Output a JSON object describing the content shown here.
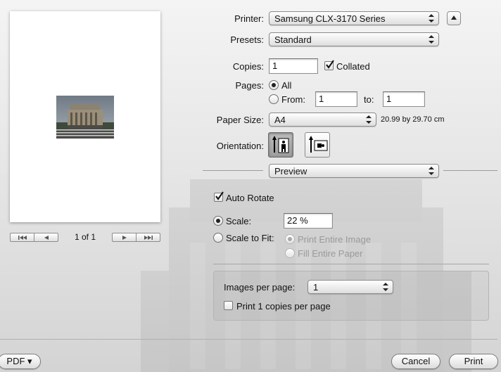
{
  "preview": {
    "page_indicator": "1 of 1"
  },
  "printer": {
    "label": "Printer:",
    "value": "Samsung CLX-3170 Series"
  },
  "presets": {
    "label": "Presets:",
    "value": "Standard"
  },
  "copies": {
    "label": "Copies:",
    "value": "1",
    "collated_label": "Collated",
    "collated_checked": true
  },
  "pages": {
    "label": "Pages:",
    "all_label": "All",
    "from_label": "From:",
    "from_value": "1",
    "to_label": "to:",
    "to_value": "1"
  },
  "paper_size": {
    "label": "Paper Size:",
    "value": "A4",
    "dimensions": "20.99 by 29.70 cm"
  },
  "orientation": {
    "label": "Orientation:",
    "selected": "portrait"
  },
  "section": {
    "value": "Preview"
  },
  "auto_rotate": {
    "label": "Auto Rotate",
    "checked": true
  },
  "scale": {
    "label": "Scale:",
    "value": "22 %"
  },
  "scale_to_fit": {
    "label": "Scale to Fit:",
    "print_entire_label": "Print Entire Image",
    "fill_entire_label": "Fill Entire Paper"
  },
  "images_per_page": {
    "label": "Images per page:",
    "value": "1"
  },
  "print_copies_per_page": {
    "label": "Print 1 copies per page",
    "checked": false
  },
  "footer": {
    "pdf_label": "PDF ▾",
    "cancel_label": "Cancel",
    "print_label": "Print"
  },
  "colors": {
    "panel": "#e6e6e6",
    "text": "#111111",
    "disabled_text": "#9a9a9a"
  }
}
